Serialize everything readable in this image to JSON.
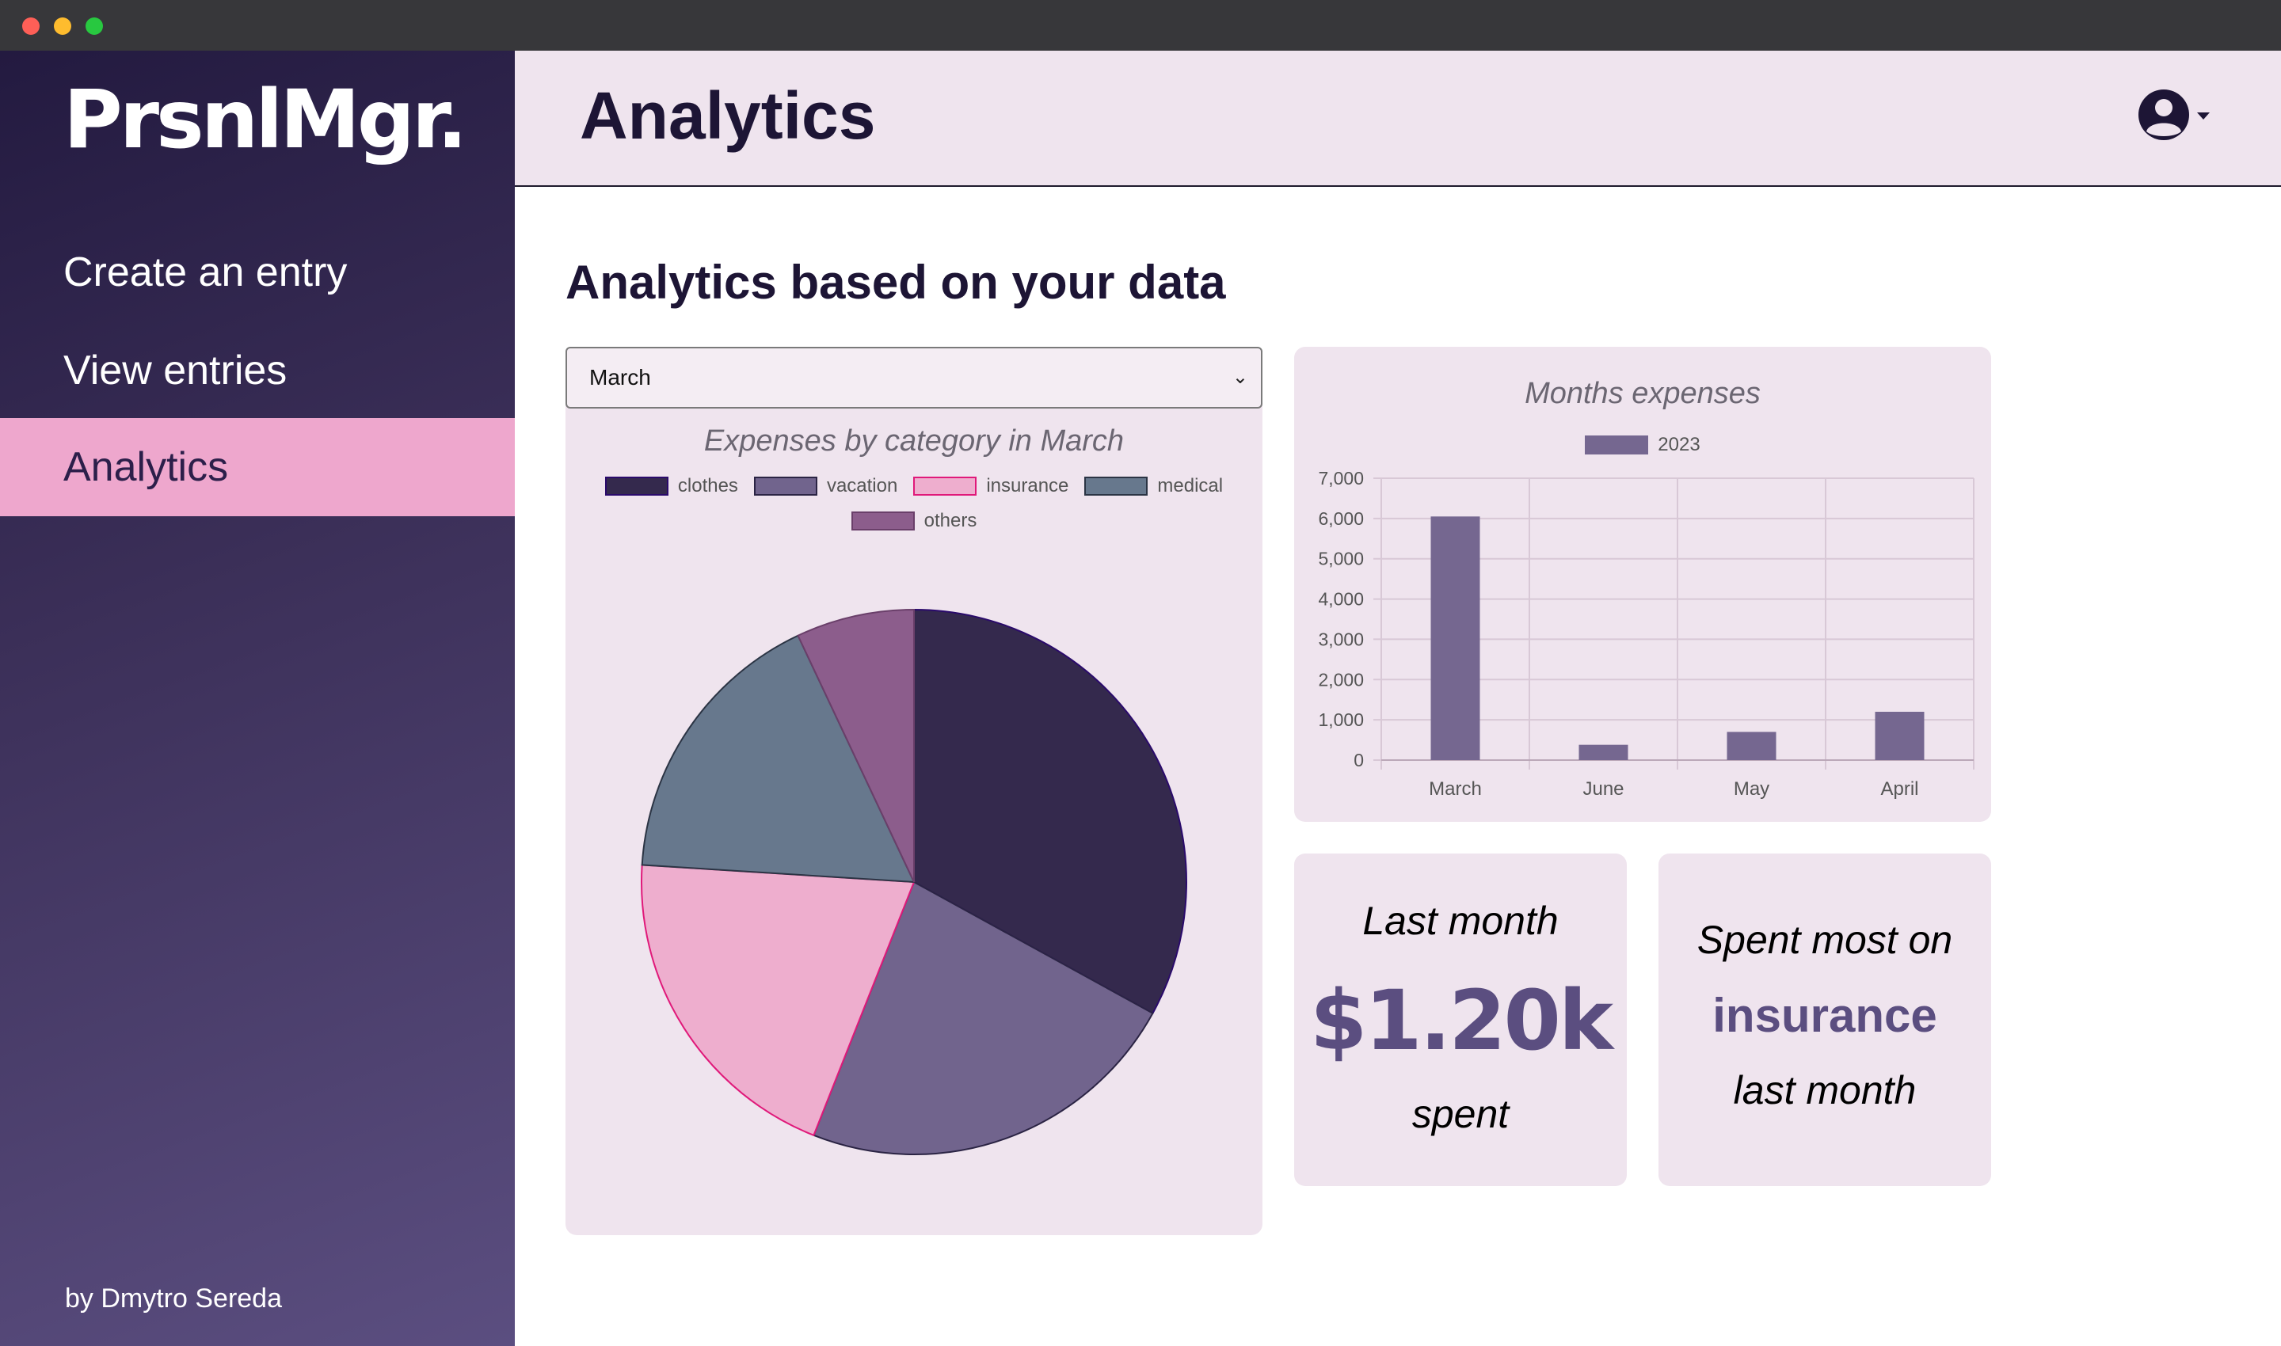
{
  "app": {
    "logo": "PrsnlMgr.",
    "author": "by Dmytro Sereda"
  },
  "sidebar": {
    "items": [
      {
        "label": "Create an entry"
      },
      {
        "label": "View entries"
      },
      {
        "label": "Analytics",
        "active": true
      }
    ]
  },
  "header": {
    "title": "Analytics",
    "account_icon": "user-circle-icon"
  },
  "main": {
    "section_title": "Analytics based on your data",
    "month_select": {
      "value": "March"
    }
  },
  "stats": {
    "last_month": {
      "label": "Last month",
      "value": "$1.20k",
      "suffix": "spent"
    },
    "top_category": {
      "prefix": "Spent most on",
      "value": "insurance",
      "suffix": "last month"
    }
  },
  "colors": {
    "sidebar_active": "#eea7cd",
    "accent": "#5b4e80",
    "card_bg": "#efe4ee"
  },
  "chart_data": [
    {
      "type": "pie",
      "title": "Expenses by category in March",
      "categories": [
        "clothes",
        "vacation",
        "insurance",
        "medical",
        "others"
      ],
      "values": [
        33,
        23,
        20,
        17,
        7
      ],
      "colors": [
        "#34294d",
        "#71648d",
        "#eeaece",
        "#67788d",
        "#8c5d8c"
      ],
      "border_colors": [
        "#2a0a6b",
        "#2b2444",
        "#e0197a",
        "#2b3444",
        "#6a3f6a"
      ],
      "legend": "top"
    },
    {
      "type": "bar",
      "title": "Months expenses",
      "categories": [
        "March",
        "June",
        "May",
        "April"
      ],
      "series": [
        {
          "name": "2023",
          "values": [
            6050,
            380,
            700,
            1200
          ]
        }
      ],
      "ylim": [
        0,
        7000
      ],
      "yticks": [
        0,
        1000,
        2000,
        3000,
        4000,
        5000,
        6000,
        7000
      ],
      "ytick_labels": [
        "0",
        "1,000",
        "2,000",
        "3,000",
        "4,000",
        "5,000",
        "6,000",
        "7,000"
      ],
      "grid": true,
      "legend": "top",
      "bar_color": "#756790"
    }
  ]
}
